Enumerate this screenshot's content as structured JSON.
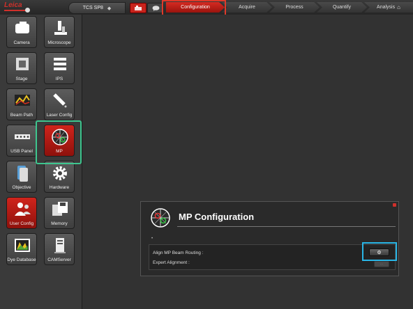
{
  "header": {
    "logo_text": "Leica",
    "system_name": "TCS SP8",
    "system_arrow": "◆",
    "mode_active_icon": "microscope-mode-icon",
    "mode_inactive_icon": "chat-mode-icon",
    "tabs": [
      {
        "label": "Configuration",
        "active": true
      },
      {
        "label": "Acquire",
        "active": false
      },
      {
        "label": "Process",
        "active": false
      },
      {
        "label": "Quantify",
        "active": false
      },
      {
        "label": "Analysis",
        "active": false
      }
    ],
    "lock_icon": "⌂"
  },
  "sidebar": {
    "tiles": [
      {
        "label": "Camera",
        "icon": "camera-icon",
        "active": false
      },
      {
        "label": "Microscope",
        "icon": "microscope-icon",
        "active": false
      },
      {
        "label": "Stage",
        "icon": "stage-icon",
        "active": false
      },
      {
        "label": "IPS",
        "icon": "ips-icon",
        "active": false
      },
      {
        "label": "Beam Path",
        "icon": "beam-path-icon",
        "active": false
      },
      {
        "label": "Laser Config",
        "icon": "laser-config-icon",
        "active": false
      },
      {
        "label": "USB Panel",
        "icon": "usb-panel-icon",
        "active": false
      },
      {
        "label": "MP",
        "icon": "mp-icon",
        "active": true
      },
      {
        "label": "Objective",
        "icon": "objective-icon",
        "active": false
      },
      {
        "label": "Hardware",
        "icon": "hardware-gear-icon",
        "active": false
      },
      {
        "label": "User Config",
        "icon": "user-config-icon",
        "active": true
      },
      {
        "label": "Memory",
        "icon": "memory-icon",
        "active": false
      },
      {
        "label": "Dye Database",
        "icon": "dye-database-icon",
        "active": false
      },
      {
        "label": "CAMServer",
        "icon": "camserver-icon",
        "active": false
      }
    ]
  },
  "panel": {
    "title": "MP Configuration",
    "dot": "•",
    "rows": [
      {
        "label": "Align MP Beam Routing :",
        "button": "⚙"
      },
      {
        "label": "Expert Alignment :",
        "button": "···"
      }
    ]
  },
  "colors": {
    "accent_red": "#c8231c",
    "highlight_red": "#e03a2a",
    "highlight_green": "#3ec68f",
    "highlight_blue": "#29b6e6"
  }
}
